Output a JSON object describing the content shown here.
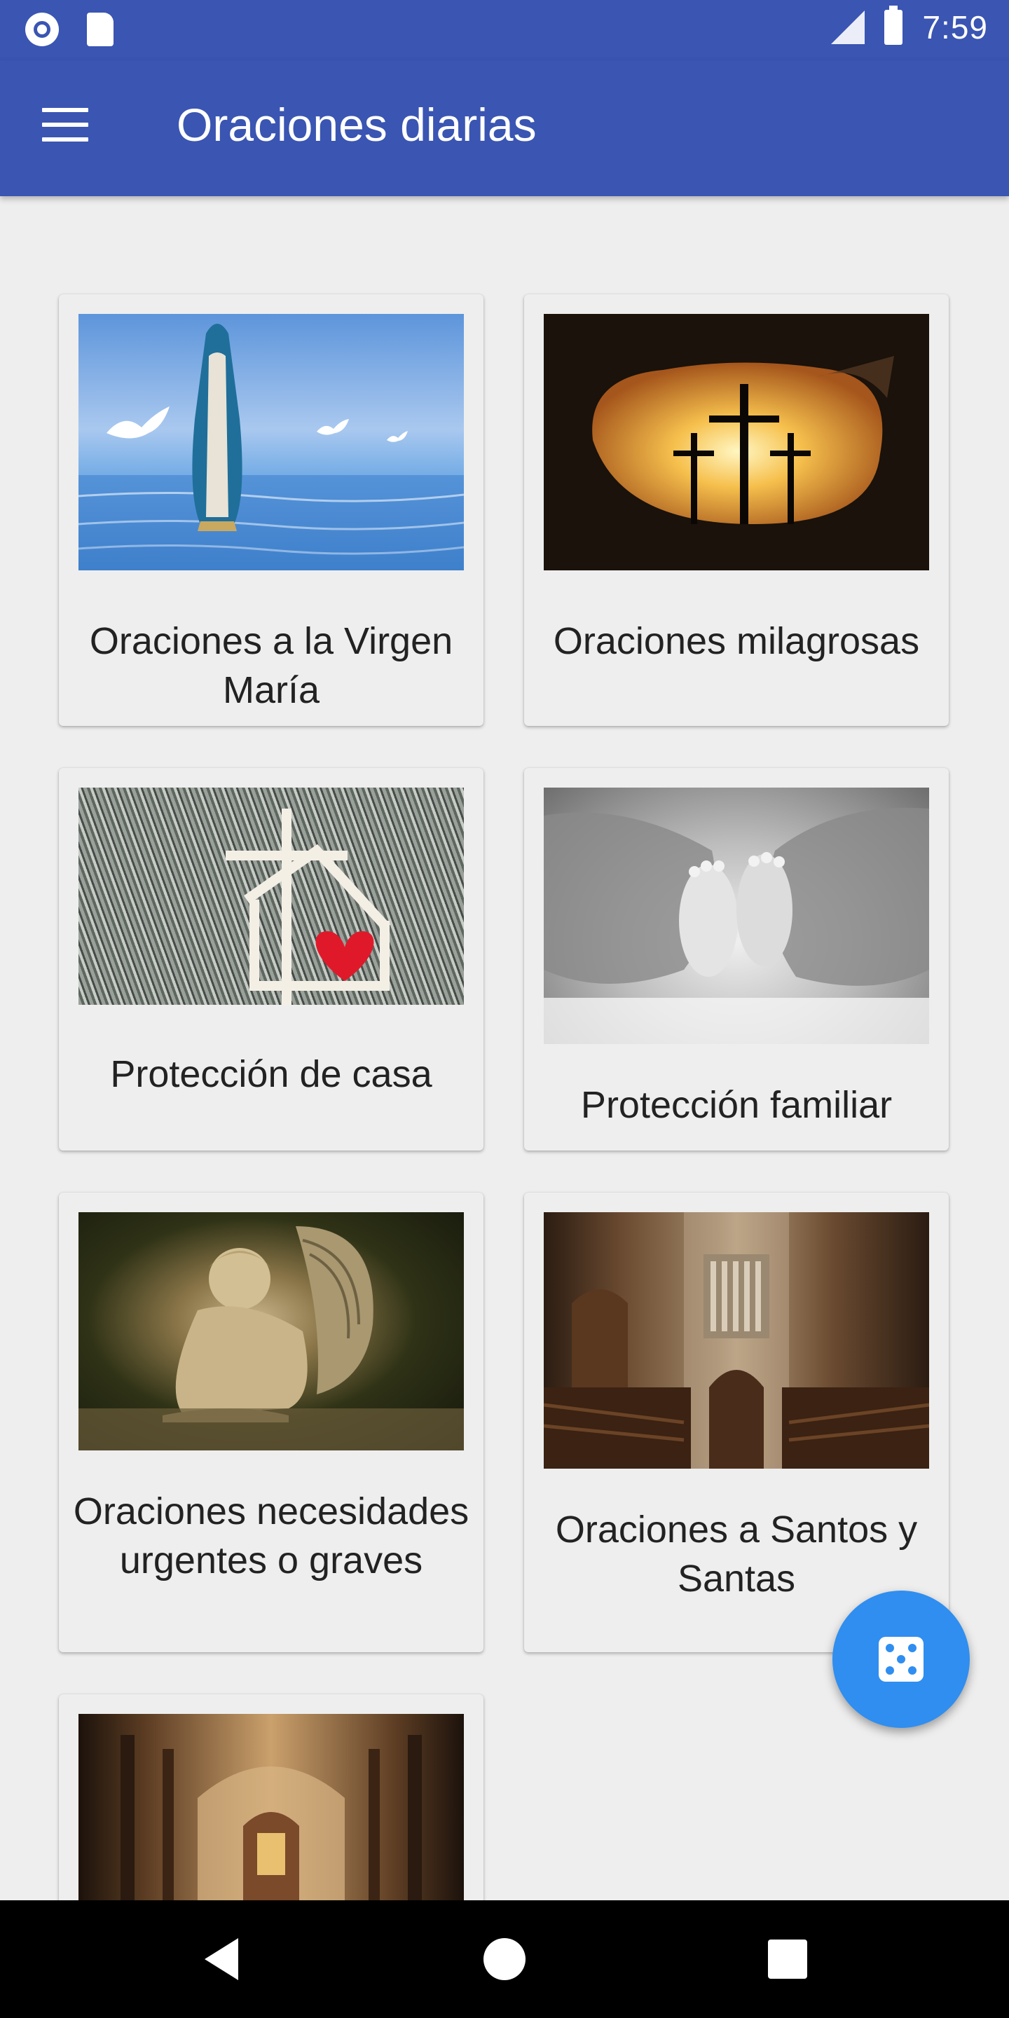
{
  "status_bar": {
    "time": "7:59",
    "icons": [
      "record-icon",
      "sd-card-icon",
      "signal-icon",
      "battery-icon"
    ]
  },
  "app_bar": {
    "title": "Oraciones diarias",
    "menu_icon": "hamburger-menu-icon"
  },
  "categories": [
    {
      "label": "Oraciones a la Virgen María",
      "image": "virgin-mary-image"
    },
    {
      "label": "Oraciones milagrosas",
      "image": "three-crosses-image"
    },
    {
      "label": "Protección de casa",
      "image": "house-cross-heart-image"
    },
    {
      "label": "Protección familiar",
      "image": "baby-feet-hands-image"
    },
    {
      "label": "Oraciones necesidades urgentes o graves",
      "image": "angel-statue-image"
    },
    {
      "label": "Oraciones a Santos y Santas",
      "image": "cathedral-organ-image"
    },
    {
      "label": "",
      "image": "cathedral-altar-image"
    }
  ],
  "fab": {
    "icon": "dice-icon"
  },
  "nav_bar": {
    "icons": [
      "back-icon",
      "home-icon",
      "recents-icon"
    ]
  },
  "colors": {
    "primary": "#3a55b2",
    "fab": "#2f8ef0",
    "background": "#eeeeee"
  }
}
